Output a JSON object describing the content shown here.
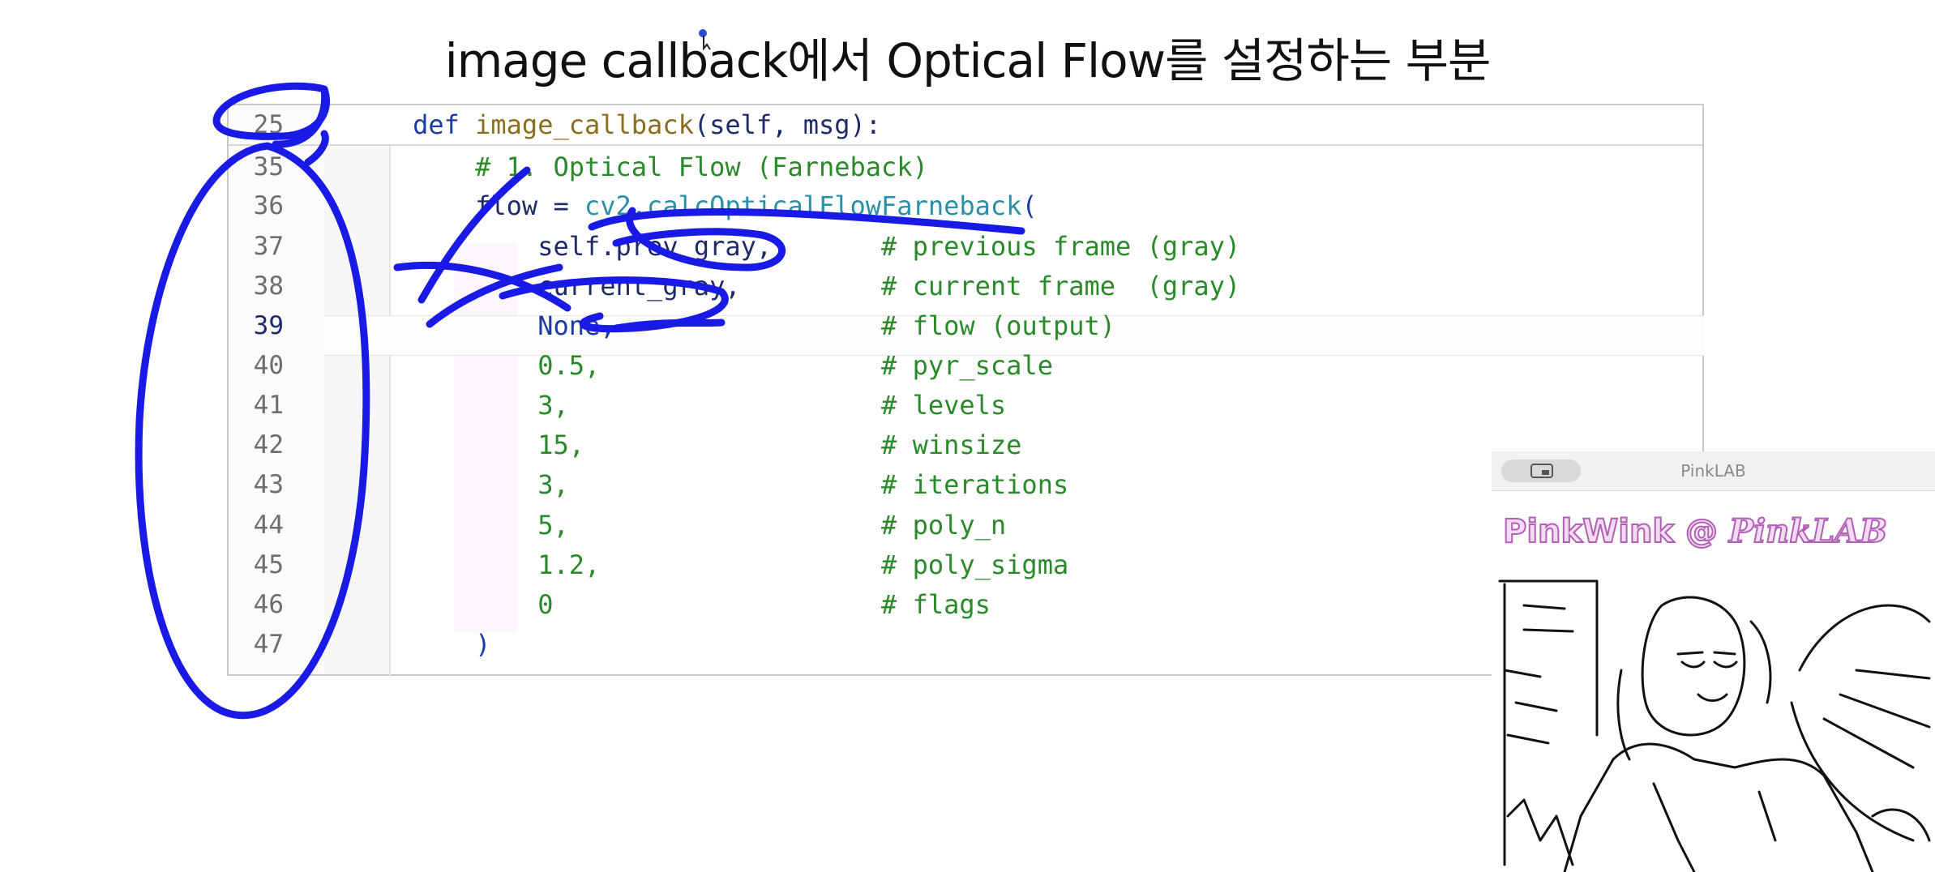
{
  "slide": {
    "title": "image callback에서 Optical Flow를 설정하는 부분"
  },
  "editor": {
    "lines": [
      {
        "num": "25",
        "segments": [
          {
            "t": "    ",
            "c": "plain"
          },
          {
            "t": "def ",
            "c": "kw"
          },
          {
            "t": "image_callback",
            "c": "fn"
          },
          {
            "t": "(self, msg):",
            "c": "plain"
          }
        ]
      },
      {
        "num": "35",
        "segments": [
          {
            "t": "        ",
            "c": "plain"
          },
          {
            "t": "# 1. Optical Flow (Farneback)",
            "c": "cmt"
          }
        ]
      },
      {
        "num": "36",
        "segments": [
          {
            "t": "        ",
            "c": "plain"
          },
          {
            "t": "flow = ",
            "c": "var"
          },
          {
            "t": "cv2.calcOpticalFlowFarneback",
            "c": "mod"
          },
          {
            "t": "(",
            "c": "dim"
          }
        ]
      },
      {
        "num": "37",
        "segments": [
          {
            "t": "            self.prev_gray,       ",
            "c": "var"
          },
          {
            "t": "# previous frame (gray)",
            "c": "cmt"
          }
        ]
      },
      {
        "num": "38",
        "segments": [
          {
            "t": "            current_gray,         ",
            "c": "var"
          },
          {
            "t": "# current frame  (gray)",
            "c": "cmt"
          }
        ]
      },
      {
        "num": "39",
        "active": true,
        "segments": [
          {
            "t": "            None,                 ",
            "c": "kw"
          },
          {
            "t": "# flow (output)",
            "c": "cmt"
          }
        ]
      },
      {
        "num": "40",
        "segments": [
          {
            "t": "            0.5,                  ",
            "c": "num"
          },
          {
            "t": "# pyr_scale",
            "c": "cmt"
          }
        ]
      },
      {
        "num": "41",
        "segments": [
          {
            "t": "            3,                    ",
            "c": "num"
          },
          {
            "t": "# levels",
            "c": "cmt"
          }
        ]
      },
      {
        "num": "42",
        "segments": [
          {
            "t": "            15,                   ",
            "c": "num"
          },
          {
            "t": "# winsize",
            "c": "cmt"
          }
        ]
      },
      {
        "num": "43",
        "segments": [
          {
            "t": "            3,                    ",
            "c": "num"
          },
          {
            "t": "# iterations",
            "c": "cmt"
          }
        ]
      },
      {
        "num": "44",
        "segments": [
          {
            "t": "            5,                    ",
            "c": "num"
          },
          {
            "t": "# poly_n",
            "c": "cmt"
          }
        ]
      },
      {
        "num": "45",
        "segments": [
          {
            "t": "            1.2,                  ",
            "c": "num"
          },
          {
            "t": "# poly_sigma",
            "c": "cmt"
          }
        ]
      },
      {
        "num": "46",
        "segments": [
          {
            "t": "            0                     ",
            "c": "num"
          },
          {
            "t": "# flags",
            "c": "cmt"
          }
        ]
      },
      {
        "num": "47",
        "segments": [
          {
            "t": "        ",
            "c": "plain"
          },
          {
            "t": ")",
            "c": "dim"
          }
        ]
      }
    ]
  },
  "video_window": {
    "title": "PinkLAB",
    "watermark_name": "PinkWink",
    "watermark_at": "@",
    "watermark_lab": "PinkLAB",
    "feed": "webcam-edge-detection"
  },
  "colors": {
    "annotation_pen": "#1a1ae6",
    "watermark_fill": "#f2dcf2",
    "watermark_stroke": "#b35fb8"
  }
}
